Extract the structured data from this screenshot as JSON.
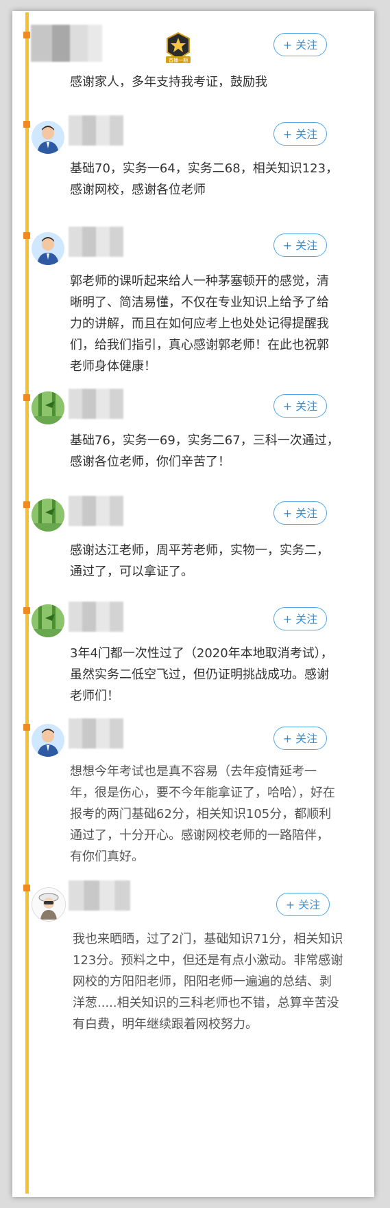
{
  "follow_label": "+ 关注",
  "badge_text": "首播一期",
  "posts": [
    {
      "avatar": "blank",
      "text": "感谢家人，多年支持我考证，鼓励我"
    },
    {
      "avatar": "person",
      "text": "基础70，实务一64，实务二68，相关知识123，感谢网校，感谢各位老师"
    },
    {
      "avatar": "person",
      "text": "郭老师的课听起来给人一种茅塞顿开的感觉，清晰明了、简洁易懂，不仅在专业知识上给予了给力的讲解，而且在如何应考上也处处记得提醒我们，给我们指引，真心感谢郭老师！在此也祝郭老师身体健康！"
    },
    {
      "avatar": "bamboo",
      "text": "基础76，实务一69，实务二67，三科一次通过，感谢各位老师，你们辛苦了！"
    },
    {
      "avatar": "bamboo",
      "text": "感谢达江老师，周平芳老师，实物一，实务二，通过了，可以拿证了。"
    },
    {
      "avatar": "bamboo",
      "text": "3年4门都一次性过了（2020年本地取消考试），虽然实务二低空飞过，但仍证明挑战成功。感谢老师们！"
    },
    {
      "avatar": "person",
      "text": "想想今年考试也是真不容易（去年疫情延考一年，很是伤心，要不今年能拿证了，哈哈），好在报考的两门基础62分，相关知识105分，都顺利通过了，十分开心。感谢网校老师的一路陪伴，有你们真好。"
    },
    {
      "avatar": "cartoon",
      "text": "我也来晒晒，过了2门，基础知识71分，相关知识123分。预料之中，但还是有点小激动。非常感谢网校的方阳阳老师，阳阳老师一遍遍的总结、剥洋葱.....相关知识的三科老师也不错，总算辛苦没有白费，明年继续跟着网校努力。"
    }
  ]
}
